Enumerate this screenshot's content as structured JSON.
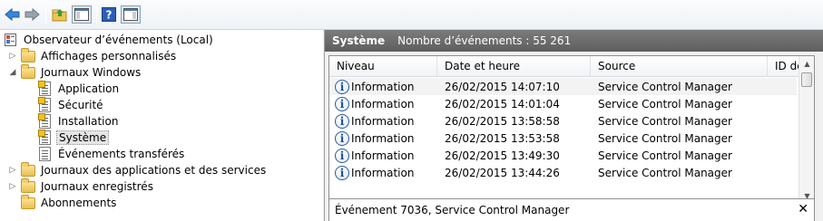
{
  "toolbar": {
    "buttons": [
      "back-icon",
      "forward-icon",
      "up-folder-icon",
      "show-hide-console-tree-icon",
      "help-icon",
      "show-hide-action-pane-icon"
    ]
  },
  "tree": {
    "root": "Observateur d’événements (Local)",
    "custom_views": "Affichages personnalisés",
    "windows_logs": "Journaux Windows",
    "logs": [
      "Application",
      "Sécurité",
      "Installation",
      "Système",
      "Événements transférés"
    ],
    "app_service_logs": "Journaux des applications et des services",
    "saved_logs": "Journaux enregistrés",
    "subscriptions": "Abonnements"
  },
  "header": {
    "title": "Système",
    "count": "Nombre d’événements : 55 261"
  },
  "table": {
    "columns": [
      "Niveau",
      "Date et heure",
      "Source",
      "ID de"
    ],
    "rows": [
      {
        "level": "Information",
        "date": "26/02/2015 14:07:10",
        "source": "Service Control Manager"
      },
      {
        "level": "Information",
        "date": "26/02/2015 14:01:04",
        "source": "Service Control Manager"
      },
      {
        "level": "Information",
        "date": "26/02/2015 13:58:58",
        "source": "Service Control Manager"
      },
      {
        "level": "Information",
        "date": "26/02/2015 13:53:58",
        "source": "Service Control Manager"
      },
      {
        "level": "Information",
        "date": "26/02/2015 13:49:30",
        "source": "Service Control Manager"
      },
      {
        "level": "Information",
        "date": "26/02/2015 13:44:26",
        "source": "Service Control Manager"
      }
    ]
  },
  "detail": {
    "title": "Événement 7036, Service Control Manager",
    "close": "✕"
  }
}
